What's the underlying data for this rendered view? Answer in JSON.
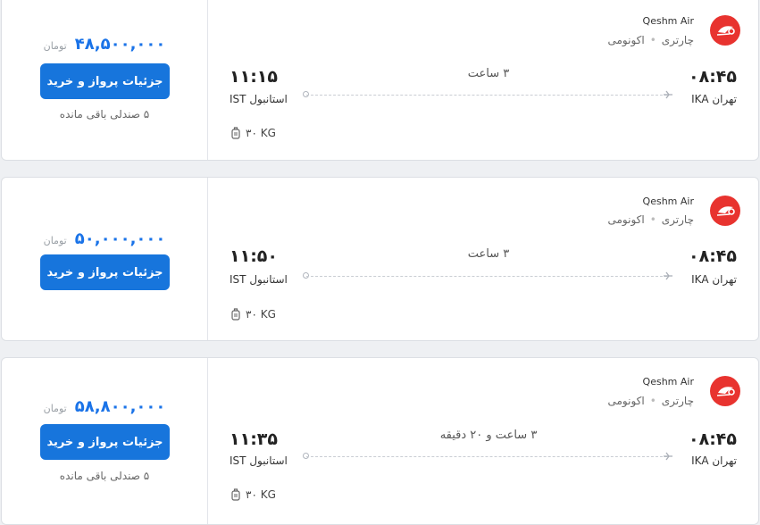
{
  "flights": [
    {
      "airline": "Qeshm Air",
      "charter": "چارتری",
      "cabin": "اکونومی",
      "dep_time": "۰۸:۴۵",
      "dep_city": "تهران IKA",
      "arr_time": "۱۱:۱۵",
      "arr_city": "استانبول IST",
      "duration": "۳ ساعت",
      "baggage": "۳۰ KG",
      "price": "۴۸,۵۰۰,۰۰۰",
      "currency": "تومان",
      "button": "جزئیات پرواز و خرید",
      "seats": "۵ صندلی باقی مانده"
    },
    {
      "airline": "Qeshm Air",
      "charter": "چارتری",
      "cabin": "اکونومی",
      "dep_time": "۰۸:۴۵",
      "dep_city": "تهران IKA",
      "arr_time": "۱۱:۵۰",
      "arr_city": "استانبول IST",
      "duration": "۳ ساعت",
      "baggage": "۳۰ KG",
      "price": "۵۰,۰۰۰,۰۰۰",
      "currency": "تومان",
      "button": "جزئیات پرواز و خرید"
    },
    {
      "airline": "Qeshm Air",
      "charter": "چارتری",
      "cabin": "اکونومی",
      "dep_time": "۰۸:۴۵",
      "dep_city": "تهران IKA",
      "arr_time": "۱۱:۳۵",
      "arr_city": "استانبول IST",
      "duration": "۳ ساعت و ۲۰ دقیقه",
      "baggage": "۳۰ KG",
      "price": "۵۸,۸۰۰,۰۰۰",
      "currency": "تومان",
      "button": "جزئیات پرواز و خرید",
      "seats": "۵ صندلی باقی مانده"
    }
  ],
  "colors": {
    "accent": "#1775dc",
    "price": "#1a73e8",
    "logo": "#e8332f"
  },
  "icons": {
    "airline_logo": "qeshm-air-logo",
    "plane": "plane-icon",
    "baggage": "luggage-icon"
  }
}
